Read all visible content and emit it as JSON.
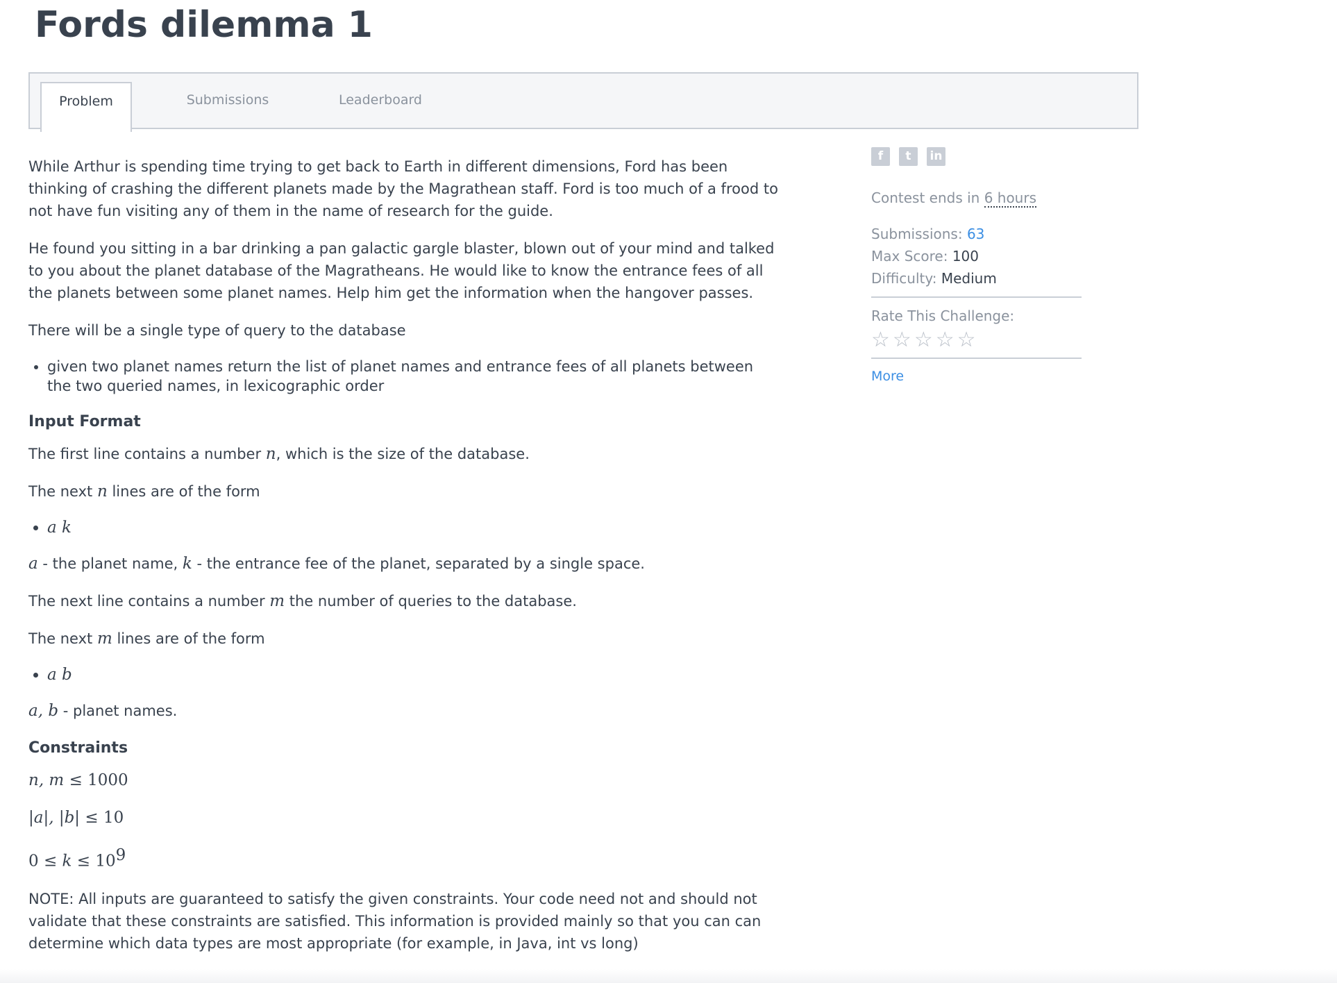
{
  "title": "Fords dilemma 1",
  "tabs": [
    "Problem",
    "Submissions",
    "Leaderboard"
  ],
  "intro": [
    "While Arthur is spending time trying to get back to Earth in different dimensions, Ford has been thinking of crashing the different planets made by the Magrathean staff. Ford is too much of a frood to not have fun visiting any of them in the name of research for the guide.",
    "He found you sitting in a bar drinking a pan galactic gargle blaster, blown out of your mind and talked to you about the planet database of the Magratheans. He would like to know the entrance fees of all the planets between some planet names. Help him get the information when the hangover passes.",
    "There will be a single type of query to the database"
  ],
  "query_bullet": "given two planet names return the list of planet names and entrance fees of all planets between the two queried names, in lexicographic order",
  "input_heading": "Input Format",
  "input": {
    "line1_pre": "The first line contains a number",
    "line1_var": "n",
    "line1_post": ", which is the size of the database.",
    "line2_pre": "The next",
    "line2_var": "n",
    "line2_post": "lines are of the form",
    "bullet1": "a k",
    "line3_var_a": "a",
    "line3_mid": "- the planet name,",
    "line3_var_k": "k",
    "line3_post": "- the entrance fee of the planet, separated by a single space.",
    "line4_pre": "The next line contains a number",
    "line4_var": "m",
    "line4_post": "the number of queries to the database.",
    "line5_pre": "The next",
    "line5_var": "m",
    "line5_post": "lines are of the form",
    "bullet2": "a b",
    "line6_var": "a, b",
    "line6_post": "- planet names."
  },
  "constraints_heading": "Constraints",
  "constraints": {
    "c1_var": "n, m",
    "c1_rest": "≤ 1000",
    "c2_var": "|a|, |b|",
    "c2_rest": "≤ 10",
    "c3_pre": "0 ≤",
    "c3_var": "k",
    "c3_rest": "≤ 10",
    "c3_sup": "9"
  },
  "note": "NOTE: All inputs are guaranteed to satisfy the given constraints. Your code need not and should not validate that these constraints are satisfied. This information is provided mainly so that you can can determine which data types are most appropriate (for example, in Java, int vs long)",
  "sidebar": {
    "contest_label": "Contest ends in",
    "contest_value": "6 hours",
    "submissions_label": "Submissions:",
    "submissions_value": "63",
    "max_score_label": "Max Score:",
    "max_score_value": "100",
    "difficulty_label": "Difficulty:",
    "difficulty_value": "Medium",
    "rate_label": "Rate This Challenge:",
    "rating": 0,
    "more_label": "More"
  },
  "icons": [
    "facebook-icon",
    "twitter-icon",
    "linkedin-icon"
  ]
}
